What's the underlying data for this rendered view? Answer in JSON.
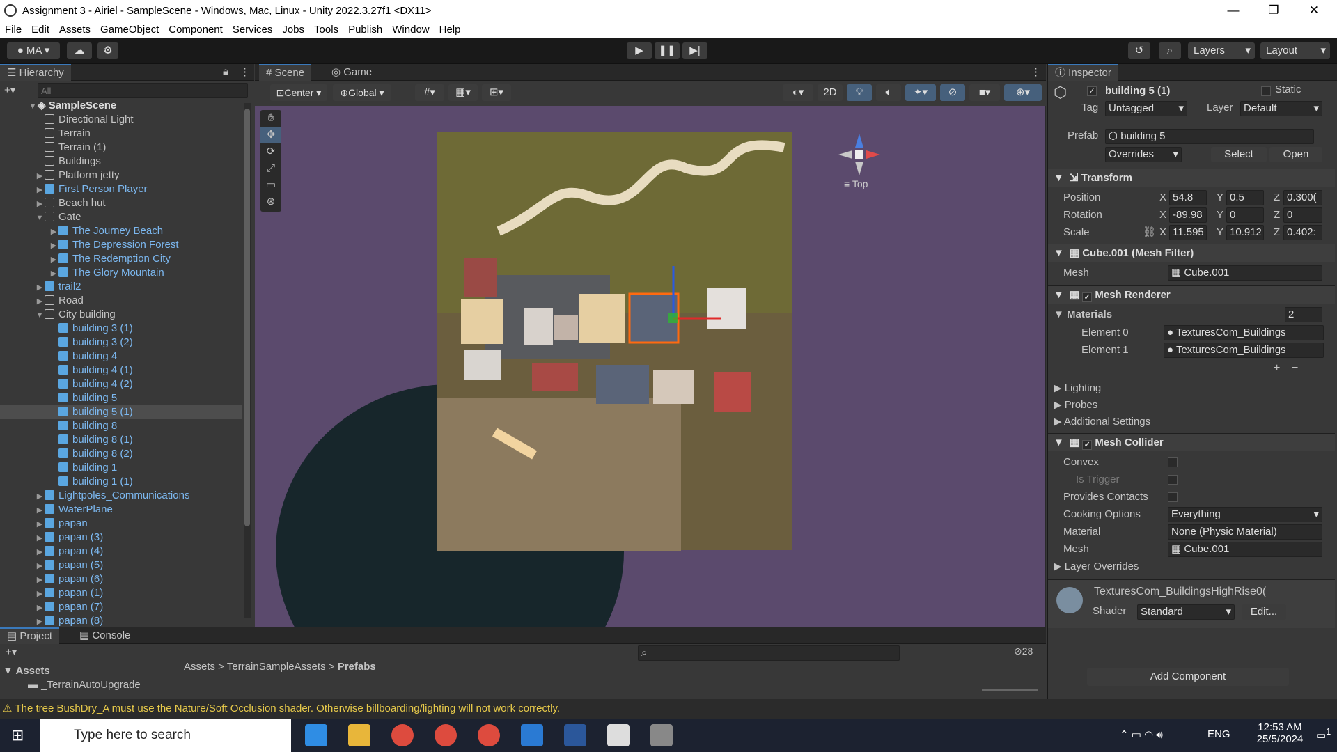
{
  "window": {
    "title": "Assignment 3 - Airiel - SampleScene - Windows, Mac, Linux - Unity 2022.3.27f1 <DX11>"
  },
  "menu": [
    "File",
    "Edit",
    "Assets",
    "GameObject",
    "Component",
    "Services",
    "Jobs",
    "Tools",
    "Publish",
    "Window",
    "Help"
  ],
  "toolbar": {
    "account": "MA",
    "layers": "Layers",
    "layout": "Layout"
  },
  "hierarchy": {
    "title": "Hierarchy",
    "search_placeholder": "All",
    "scene": "SampleScene",
    "items": [
      {
        "label": "Directional Light",
        "indent": 1,
        "arrow": "",
        "prefab": false
      },
      {
        "label": "Terrain",
        "indent": 1,
        "arrow": "",
        "prefab": false
      },
      {
        "label": "Terrain (1)",
        "indent": 1,
        "arrow": "",
        "prefab": false
      },
      {
        "label": "Buildings",
        "indent": 1,
        "arrow": "",
        "prefab": false
      },
      {
        "label": "Platform jetty",
        "indent": 1,
        "arrow": "▶",
        "prefab": false
      },
      {
        "label": "First Person Player",
        "indent": 1,
        "arrow": "▶",
        "prefab": true
      },
      {
        "label": "Beach hut",
        "indent": 1,
        "arrow": "▶",
        "prefab": false
      },
      {
        "label": "Gate",
        "indent": 1,
        "arrow": "▼",
        "prefab": false
      },
      {
        "label": "The Journey Beach",
        "indent": 2,
        "arrow": "▶",
        "prefab": true
      },
      {
        "label": "The Depression Forest",
        "indent": 2,
        "arrow": "▶",
        "prefab": true
      },
      {
        "label": "The Redemption City",
        "indent": 2,
        "arrow": "▶",
        "prefab": true
      },
      {
        "label": "The Glory Mountain",
        "indent": 2,
        "arrow": "▶",
        "prefab": true
      },
      {
        "label": "trail2",
        "indent": 1,
        "arrow": "▶",
        "prefab": true
      },
      {
        "label": "Road",
        "indent": 1,
        "arrow": "▶",
        "prefab": false
      },
      {
        "label": "City building",
        "indent": 1,
        "arrow": "▼",
        "prefab": false
      },
      {
        "label": "building 3 (1)",
        "indent": 2,
        "arrow": "",
        "prefab": true
      },
      {
        "label": "building 3 (2)",
        "indent": 2,
        "arrow": "",
        "prefab": true
      },
      {
        "label": "building 4",
        "indent": 2,
        "arrow": "",
        "prefab": true
      },
      {
        "label": "building 4 (1)",
        "indent": 2,
        "arrow": "",
        "prefab": true
      },
      {
        "label": "building 4 (2)",
        "indent": 2,
        "arrow": "",
        "prefab": true
      },
      {
        "label": "building 5",
        "indent": 2,
        "arrow": "",
        "prefab": true
      },
      {
        "label": "building 5 (1)",
        "indent": 2,
        "arrow": "",
        "prefab": true,
        "selected": true
      },
      {
        "label": "building 8",
        "indent": 2,
        "arrow": "",
        "prefab": true
      },
      {
        "label": "building 8 (1)",
        "indent": 2,
        "arrow": "",
        "prefab": true
      },
      {
        "label": "building 8 (2)",
        "indent": 2,
        "arrow": "",
        "prefab": true
      },
      {
        "label": "building 1",
        "indent": 2,
        "arrow": "",
        "prefab": true
      },
      {
        "label": "building 1 (1)",
        "indent": 2,
        "arrow": "",
        "prefab": true
      },
      {
        "label": "Lightpoles_Communications",
        "indent": 1,
        "arrow": "▶",
        "prefab": true
      },
      {
        "label": "WaterPlane",
        "indent": 1,
        "arrow": "▶",
        "prefab": true
      },
      {
        "label": "papan",
        "indent": 1,
        "arrow": "▶",
        "prefab": true
      },
      {
        "label": "papan (3)",
        "indent": 1,
        "arrow": "▶",
        "prefab": true
      },
      {
        "label": "papan (4)",
        "indent": 1,
        "arrow": "▶",
        "prefab": true
      },
      {
        "label": "papan (5)",
        "indent": 1,
        "arrow": "▶",
        "prefab": true
      },
      {
        "label": "papan (6)",
        "indent": 1,
        "arrow": "▶",
        "prefab": true
      },
      {
        "label": "papan (1)",
        "indent": 1,
        "arrow": "▶",
        "prefab": true
      },
      {
        "label": "papan (7)",
        "indent": 1,
        "arrow": "▶",
        "prefab": true
      },
      {
        "label": "papan (8)",
        "indent": 1,
        "arrow": "▶",
        "prefab": true
      }
    ]
  },
  "scene": {
    "tab_scene": "Scene",
    "tab_game": "Game",
    "pivot": "Center",
    "space": "Global",
    "mode2d": "2D",
    "view_label": "Top"
  },
  "inspector": {
    "title": "Inspector",
    "object_name": "building 5 (1)",
    "static": "Static",
    "tag_label": "Tag",
    "tag": "Untagged",
    "layer_label": "Layer",
    "layer": "Default",
    "prefab_label": "Prefab",
    "prefab": "building 5",
    "overrides": "Overrides",
    "select": "Select",
    "open": "Open",
    "transform": {
      "title": "Transform",
      "position": {
        "label": "Position",
        "x": "54.8",
        "y": "0.5",
        "z": "0.300("
      },
      "rotation": {
        "label": "Rotation",
        "x": "-89.98",
        "y": "0",
        "z": "0"
      },
      "scale": {
        "label": "Scale",
        "x": "11.595",
        "y": "10.912",
        "z": "0.402:"
      }
    },
    "mesh_filter": {
      "title": "Cube.001 (Mesh Filter)",
      "mesh_label": "Mesh",
      "mesh": "Cube.001"
    },
    "mesh_renderer": {
      "title": "Mesh Renderer",
      "materials_label": "Materials",
      "materials_count": "2",
      "elements": [
        {
          "label": "Element 0",
          "value": "TexturesCom_Buildings"
        },
        {
          "label": "Element 1",
          "value": "TexturesCom_Buildings"
        }
      ]
    },
    "sections": [
      "Lighting",
      "Probes",
      "Additional Settings"
    ],
    "mesh_collider": {
      "title": "Mesh Collider",
      "convex": "Convex",
      "is_trigger": "Is Trigger",
      "provides_contacts": "Provides Contacts",
      "cooking_label": "Cooking Options",
      "cooking": "Everything",
      "material_label": "Material",
      "material": "None (Physic Material)",
      "mesh_label": "Mesh",
      "mesh": "Cube.001",
      "layer_overrides": "Layer Overrides"
    },
    "material_asset": {
      "name": "TexturesCom_BuildingsHighRise0(",
      "shader_label": "Shader",
      "shader": "Standard",
      "edit": "Edit..."
    },
    "add_component": "Add Component"
  },
  "project": {
    "tab_project": "Project",
    "tab_console": "Console",
    "breadcrumb": [
      "Assets",
      "TerrainSampleAssets",
      "Prefabs"
    ],
    "tree": [
      "Assets",
      "_TerrainAutoUpgrade"
    ],
    "hidden_count": "28"
  },
  "status": {
    "message": "The tree BushDry_A must use the Nature/Soft Occlusion shader. Otherwise billboarding/lighting will not work correctly."
  },
  "taskbar": {
    "search": "Type here to search",
    "lang": "ENG",
    "time": "12:53 AM",
    "date": "25/5/2024",
    "notif": "1"
  },
  "colors": {
    "accent": "#3a79bb",
    "prefab": "#7cb8f0",
    "warning": "#e6c94a"
  }
}
